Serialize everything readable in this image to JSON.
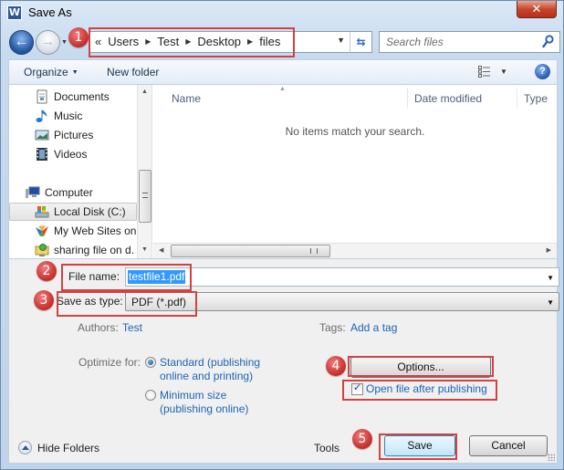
{
  "window": {
    "title": "Save As",
    "app_icon_letter": "W",
    "close_glyph": "✕"
  },
  "nav": {
    "back_glyph": "←",
    "forward_glyph": "→",
    "breadcrumb_prefix": "«",
    "breadcrumb": [
      "Users",
      "Test",
      "Desktop",
      "files"
    ],
    "breadcrumb_sep": "▶",
    "refresh_glyph": "⇆",
    "search_placeholder": "Search files"
  },
  "toolbar": {
    "organize_label": "Organize",
    "new_folder_label": "New folder"
  },
  "sidebar": {
    "items": [
      {
        "label": "Documents",
        "icon": "documents-icon"
      },
      {
        "label": "Music",
        "icon": "music-icon"
      },
      {
        "label": "Pictures",
        "icon": "pictures-icon"
      },
      {
        "label": "Videos",
        "icon": "videos-icon"
      },
      {
        "label": "Computer",
        "icon": "computer-icon"
      },
      {
        "label": "Local Disk (C:)",
        "icon": "local-disk-icon",
        "selected": true
      },
      {
        "label": "My Web Sites on",
        "icon": "web-sites-icon"
      },
      {
        "label": "sharing file on d.",
        "icon": "network-share-icon"
      }
    ]
  },
  "list": {
    "columns": [
      "Name",
      "Date modified",
      "Type"
    ],
    "empty_message": "No items match your search."
  },
  "form": {
    "file_name_label": "File name:",
    "file_name_value": "testfile1.pdf",
    "save_type_label": "Save as type:",
    "save_type_value": "PDF (*.pdf)",
    "authors_label": "Authors:",
    "authors_value": "Test",
    "tags_label": "Tags:",
    "tags_value": "Add a tag",
    "optimize_label": "Optimize for:",
    "optimize_options": [
      {
        "line1": "Standard (publishing",
        "line2": "online and printing)",
        "checked": true
      },
      {
        "line1": "Minimum size",
        "line2": "(publishing online)",
        "checked": false
      }
    ],
    "options_button": "Options...",
    "open_after_label": "Open file after publishing",
    "open_after_checked": true
  },
  "footer": {
    "hide_folders_label": "Hide Folders",
    "tools_label": "Tools",
    "save_button": "Save",
    "cancel_button": "Cancel"
  },
  "annotations": {
    "badges": [
      "1",
      "2",
      "3",
      "4",
      "5"
    ],
    "color": "#d04343"
  }
}
